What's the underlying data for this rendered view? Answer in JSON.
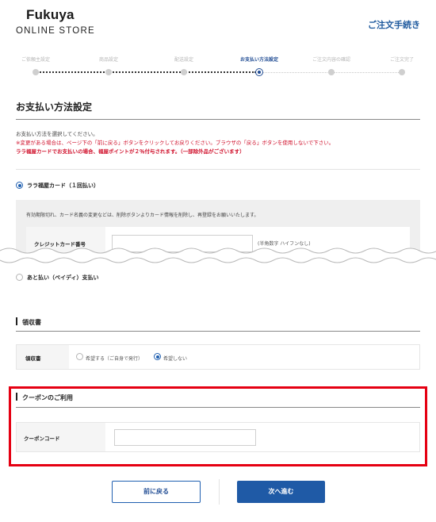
{
  "header": {
    "logo_main": "Fukuya",
    "logo_sub": "ONLINE STORE",
    "title_right": "ご注文手続き"
  },
  "steps": [
    {
      "label": "ご依頼主設定",
      "state": "done"
    },
    {
      "label": "商品設定",
      "state": "done"
    },
    {
      "label": "配送設定",
      "state": "done"
    },
    {
      "label": "お支払い方法設定",
      "state": "active"
    },
    {
      "label": "ご注文内容の確認",
      "state": "todo"
    },
    {
      "label": "ご注文完了",
      "state": "todo"
    }
  ],
  "page": {
    "title": "お支払い方法設定",
    "notes": [
      "お支払い方法を選択してください。",
      "※変更がある場合は、ページ下の「前に戻る」ボタンをクリックしてお戻りください。ブラウザの「戻る」ボタンを使用しないで下さい。",
      "ララ福屋カードでお支払いの場合、福屋ポイントが２％付与されます。（一部除外品がございます）"
    ]
  },
  "payment": {
    "options": [
      {
        "label": "ララ福屋カード（１回払い）",
        "selected": true
      },
      {
        "label": "あと払い（ペイディ）支払い",
        "selected": false
      }
    ],
    "card_panel_note": "有効期限切れ、カード名義の変更などは、削除ボタンよりカード情報を削除し、再登録をお願いいたします。",
    "card_number_label": "クレジットカード番号",
    "card_number_value": "",
    "card_number_hint": "(半角数字 ハイフンなし)"
  },
  "receipt": {
    "heading": "領収書",
    "row_label": "領収書",
    "choices": [
      {
        "label": "希望する（ご自身で発行）",
        "selected": false
      },
      {
        "label": "希望しない",
        "selected": true
      }
    ]
  },
  "coupon": {
    "heading": "クーポンのご利用",
    "row_label": "クーポンコード",
    "value": ""
  },
  "buttons": {
    "back": "前に戻る",
    "next": "次へ進む"
  },
  "colors": {
    "accent_blue": "#1f5aa6",
    "highlight_red": "#e50012",
    "warning_red": "#d0102b"
  }
}
